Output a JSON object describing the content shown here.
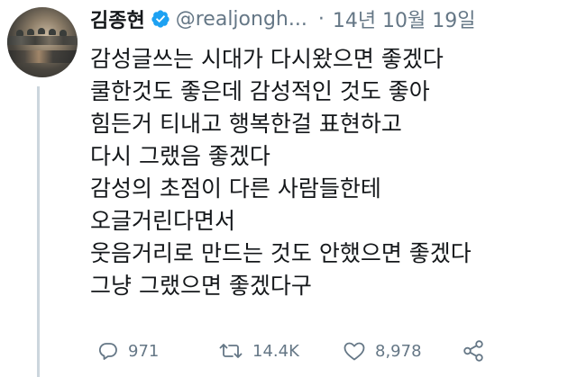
{
  "tweet": {
    "author": {
      "display_name": "김종현",
      "handle": "@realjongh...",
      "verified": true
    },
    "separator": "·",
    "date": "14년 10월 19일",
    "text_lines": [
      "감성글쓰는 시대가 다시왔으면 좋겠다",
      "쿨한것도 좋은데 감성적인 것도 좋아",
      "힘든거 티내고 행복한걸 표현하고",
      "다시 그랬음 좋겠다",
      "감성의 초점이 다른 사람들한테",
      "오글거린다면서",
      "웃음거리로 만드는 것도 안했으면 좋겠다",
      "그냥 그랬으면 좋겠다구"
    ],
    "actions": {
      "reply_count": "971",
      "retweet_count": "14.4K",
      "like_count": "8,978"
    }
  },
  "icons": {
    "verified": "verified-badge-icon",
    "reply": "reply-icon",
    "retweet": "retweet-icon",
    "like": "heart-icon",
    "share": "share-icon"
  },
  "colors": {
    "text_primary": "#14171a",
    "text_secondary": "#657786",
    "verified_blue": "#1da1f2",
    "thread_line": "#ccd6dd"
  }
}
